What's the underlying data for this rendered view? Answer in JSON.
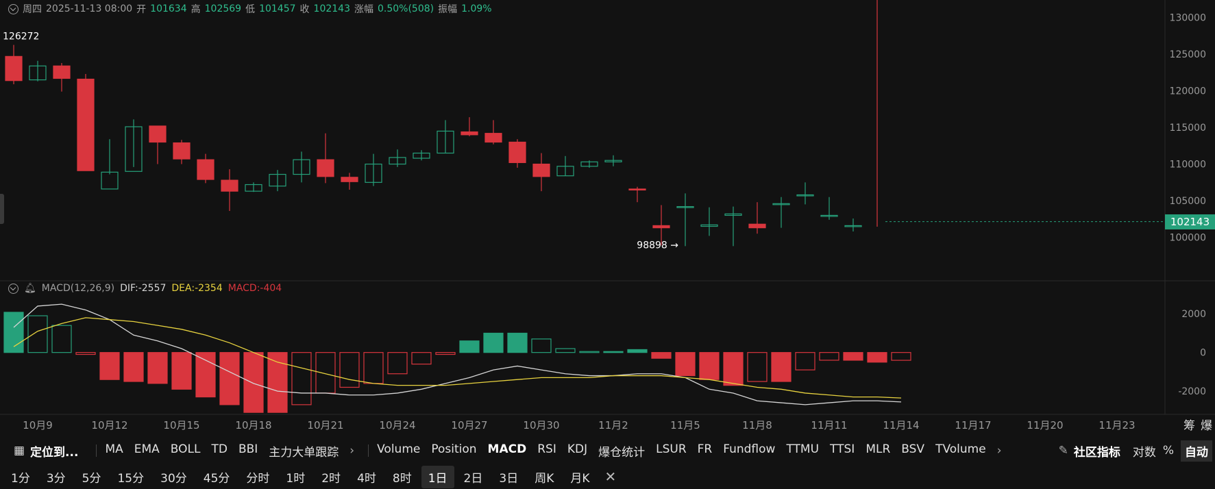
{
  "header": {
    "weekday": "周四",
    "datetime": "2025-11-13 08:00",
    "open_label": "开",
    "open": "101634",
    "high_label": "高",
    "high": "102569",
    "low_label": "低",
    "low": "101457",
    "close_label": "收",
    "close": "102143",
    "change_label": "涨幅",
    "change": "0.50%(508)",
    "amp_label": "振幅",
    "amp": "1.09%"
  },
  "macd_header": {
    "name": "MACD(12,26,9)",
    "dif": "DIF:-2557",
    "dea": "DEA:-2354",
    "macd": "MACD:-404"
  },
  "current_price": "102143",
  "annotations": {
    "high": "126272",
    "low": "98898"
  },
  "colors": {
    "up": "#26a17b",
    "down": "#d9363e",
    "dif": "#d6d6d6",
    "dea": "#e8d33f",
    "bg": "#121212"
  },
  "bottom_right": {
    "chou": "筹",
    "bao": "爆"
  },
  "toolbar": {
    "locate": "定位到...",
    "main_indicators": [
      "MA",
      "EMA",
      "BOLL",
      "TD",
      "BBI",
      "主力大单跟踪"
    ],
    "sub_indicators": [
      "Volume",
      "Position",
      "MACD",
      "RSI",
      "KDJ",
      "爆仓统计",
      "LSUR",
      "FR",
      "Fundflow",
      "TTMU",
      "TTSI",
      "MLR",
      "BSV",
      "TVolume"
    ],
    "active_sub": "MACD",
    "community": "社区指标",
    "log": "对数",
    "pct": "%",
    "auto": "自动"
  },
  "timeframes": [
    "1分",
    "3分",
    "5分",
    "15分",
    "30分",
    "45分",
    "分时",
    "1时",
    "2时",
    "4时",
    "8时",
    "1日",
    "2日",
    "3日",
    "周K",
    "月K"
  ],
  "active_timeframe": "1日",
  "chart_data": [
    {
      "type": "candlestick",
      "x": [
        "2025-10-08",
        "2025-10-09",
        "2025-10-10",
        "2025-10-11",
        "2025-10-12",
        "2025-10-13",
        "2025-10-14",
        "2025-10-15",
        "2025-10-16",
        "2025-10-17",
        "2025-10-18",
        "2025-10-19",
        "2025-10-20",
        "2025-10-21",
        "2025-10-22",
        "2025-10-23",
        "2025-10-24",
        "2025-10-25",
        "2025-10-26",
        "2025-10-27",
        "2025-10-28",
        "2025-10-29",
        "2025-10-30",
        "2025-10-31",
        "2025-11-01",
        "2025-11-02",
        "2025-11-03",
        "2025-11-04",
        "2025-11-05",
        "2025-11-06",
        "2025-11-07",
        "2025-11-08",
        "2025-11-09",
        "2025-11-10",
        "2025-11-11",
        "2025-11-12",
        "2025-11-13"
      ],
      "open": [
        124700,
        121500,
        123400,
        121600,
        106600,
        109000,
        115200,
        112900,
        110600,
        107800,
        106300,
        107000,
        108600,
        110600,
        108200,
        107500,
        110000,
        110800,
        111500,
        114400,
        114200,
        113000,
        110000,
        108400,
        109700,
        110300,
        106600,
        101600,
        104200,
        101500,
        103000,
        101800,
        104500,
        105800,
        103000,
        101600
      ],
      "close": [
        121400,
        123400,
        121700,
        109100,
        108900,
        115100,
        113000,
        110700,
        107900,
        106300,
        107200,
        108600,
        110600,
        108300,
        107600,
        110000,
        110900,
        111500,
        114500,
        114000,
        113000,
        110200,
        108300,
        109700,
        110300,
        110500,
        106500,
        101300,
        104200,
        101700,
        103200,
        101300,
        104600,
        105800,
        103000,
        101600,
        102143
      ],
      "high": [
        126272,
        124100,
        123800,
        122300,
        113400,
        116100,
        115100,
        113300,
        111400,
        109300,
        107500,
        109200,
        111700,
        114200,
        108800,
        111400,
        112000,
        111900,
        116000,
        116400,
        116000,
        113400,
        111500,
        111100,
        110500,
        111200,
        106900,
        104400,
        106000,
        104100,
        104200,
        104800,
        105500,
        107500,
        105500,
        102569
      ],
      "low": [
        120900,
        121300,
        119900,
        109600,
        108600,
        109600,
        110000,
        110000,
        107400,
        103600,
        106200,
        106300,
        107500,
        107400,
        106500,
        107000,
        109600,
        110500,
        111500,
        113800,
        112700,
        109500,
        106300,
        108400,
        109500,
        109700,
        104800,
        98898,
        98800,
        100200,
        98800,
        100500,
        101300,
        104500,
        102400,
        100800,
        101457
      ],
      "ylim": [
        95000,
        131000
      ],
      "yticks": [
        100000,
        105000,
        110000,
        115000,
        120000,
        125000,
        130000
      ],
      "xticks": [
        "10月9",
        "10月12",
        "10月15",
        "10月18",
        "10月21",
        "10月24",
        "10月27",
        "10月30",
        "11月2",
        "11月5",
        "11月8",
        "11月11",
        "11月14",
        "11月17",
        "11月20",
        "11月23"
      ]
    },
    {
      "type": "macd",
      "x": [
        "2025-10-08",
        "2025-10-09",
        "2025-10-10",
        "2025-10-11",
        "2025-10-12",
        "2025-10-13",
        "2025-10-14",
        "2025-10-15",
        "2025-10-16",
        "2025-10-17",
        "2025-10-18",
        "2025-10-19",
        "2025-10-20",
        "2025-10-21",
        "2025-10-22",
        "2025-10-23",
        "2025-10-24",
        "2025-10-25",
        "2025-10-26",
        "2025-10-27",
        "2025-10-28",
        "2025-10-29",
        "2025-10-30",
        "2025-10-31",
        "2025-11-01",
        "2025-11-02",
        "2025-11-03",
        "2025-11-04",
        "2025-11-05",
        "2025-11-06",
        "2025-11-07",
        "2025-11-08",
        "2025-11-09",
        "2025-11-10",
        "2025-11-11",
        "2025-11-12",
        "2025-11-13"
      ],
      "macd": [
        2080,
        1900,
        1400,
        -100,
        -1400,
        -1500,
        -1600,
        -1900,
        -2300,
        -2700,
        -3100,
        -3100,
        -2700,
        -2100,
        -1800,
        -1600,
        -1100,
        -600,
        -100,
        600,
        1000,
        1000,
        700,
        200,
        50,
        50,
        150,
        -300,
        -1200,
        -1400,
        -1700,
        -1500,
        -1500,
        -900,
        -400,
        -400,
        -500,
        -404
      ],
      "dif": [
        1300,
        2400,
        2500,
        2200,
        1700,
        900,
        600,
        200,
        -400,
        -1000,
        -1600,
        -2000,
        -2100,
        -2100,
        -2200,
        -2200,
        -2100,
        -1900,
        -1600,
        -1300,
        -900,
        -700,
        -900,
        -1100,
        -1200,
        -1200,
        -1100,
        -1100,
        -1300,
        -1900,
        -2100,
        -2500,
        -2600,
        -2700,
        -2600,
        -2500,
        -2500,
        -2557
      ],
      "dea": [
        300,
        1100,
        1500,
        1800,
        1700,
        1600,
        1400,
        1200,
        900,
        500,
        0,
        -500,
        -800,
        -1100,
        -1400,
        -1600,
        -1700,
        -1700,
        -1700,
        -1600,
        -1500,
        -1400,
        -1300,
        -1300,
        -1300,
        -1200,
        -1200,
        -1200,
        -1300,
        -1400,
        -1600,
        -1800,
        -1900,
        -2100,
        -2200,
        -2300,
        -2300,
        -2354
      ],
      "ylim": [
        -3200,
        3000
      ],
      "yticks": [
        -2000,
        0,
        2000
      ]
    }
  ]
}
